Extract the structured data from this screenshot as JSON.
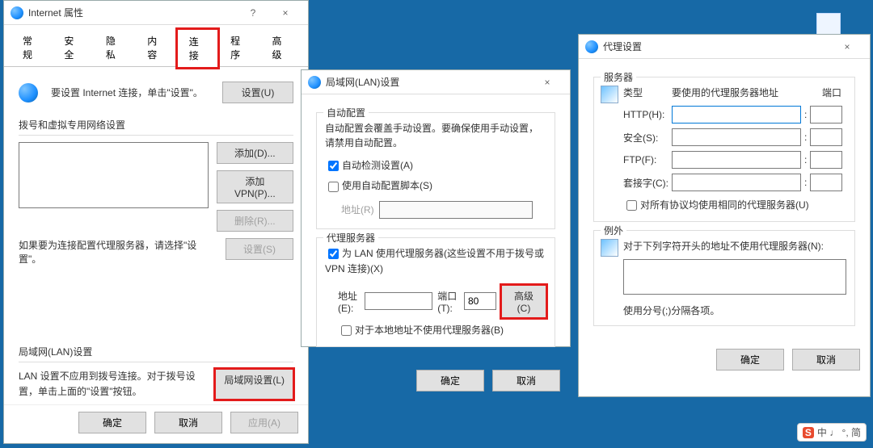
{
  "desktop": {
    "os_theme": "Windows 10 blue desktop"
  },
  "internet_properties": {
    "title": "Internet 属性",
    "help": "?",
    "close": "×",
    "tabs": {
      "general": "常规",
      "security": "安全",
      "privacy": "隐私",
      "content": "内容",
      "connections": "连接",
      "programs": "程序",
      "advanced": "高级"
    },
    "conn_text": "要设置 Internet 连接，单击\"设置\"。",
    "setup_btn": "设置(U)",
    "dialup_section": "拨号和虚拟专用网络设置",
    "add_btn": "添加(D)...",
    "add_vpn_btn": "添加 VPN(P)...",
    "remove_btn": "删除(R)...",
    "settings_btn": "设置(S)",
    "dialup_note": "如果要为连接配置代理服务器，请选择\"设置\"。",
    "lan_section": "局域网(LAN)设置",
    "lan_note": "LAN 设置不应用到拨号连接。对于拨号设置，单击上面的\"设置\"按钮。",
    "lan_btn": "局域网设置(L)",
    "ok": "确定",
    "cancel": "取消",
    "apply": "应用(A)"
  },
  "lan_settings": {
    "title": "局域网(LAN)设置",
    "close": "×",
    "auto_section": "自动配置",
    "auto_note": "自动配置会覆盖手动设置。要确保使用手动设置，请禁用自动配置。",
    "auto_detect": "自动检测设置(A)",
    "auto_script": "使用自动配置脚本(S)",
    "addr_label": "地址(R)",
    "proxy_section": "代理服务器",
    "use_proxy": "为 LAN 使用代理服务器(这些设置不用于拨号或 VPN 连接)(X)",
    "addr_e": "地址(E):",
    "port_t": "端口(T):",
    "port_value": "80",
    "advanced_btn": "高级(C)",
    "bypass_local": "对于本地地址不使用代理服务器(B)",
    "ok": "确定",
    "cancel": "取消"
  },
  "proxy_settings": {
    "title": "代理设置",
    "close": "×",
    "server_section": "服务器",
    "type_hdr": "类型",
    "addr_hdr": "要使用的代理服务器地址",
    "port_hdr": "端口",
    "http": "HTTP(H):",
    "secure": "安全(S):",
    "ftp": "FTP(F):",
    "socks": "套接字(C):",
    "same_for_all": "对所有协议均使用相同的代理服务器(U)",
    "exceptions_section": "例外",
    "exceptions_note": "对于下列字符开头的地址不使用代理服务器(N):",
    "semicolon_note": "使用分号(;)分隔各项。",
    "ok": "确定",
    "cancel": "取消"
  },
  "ime": {
    "text": "中 ♩ °, 简"
  }
}
